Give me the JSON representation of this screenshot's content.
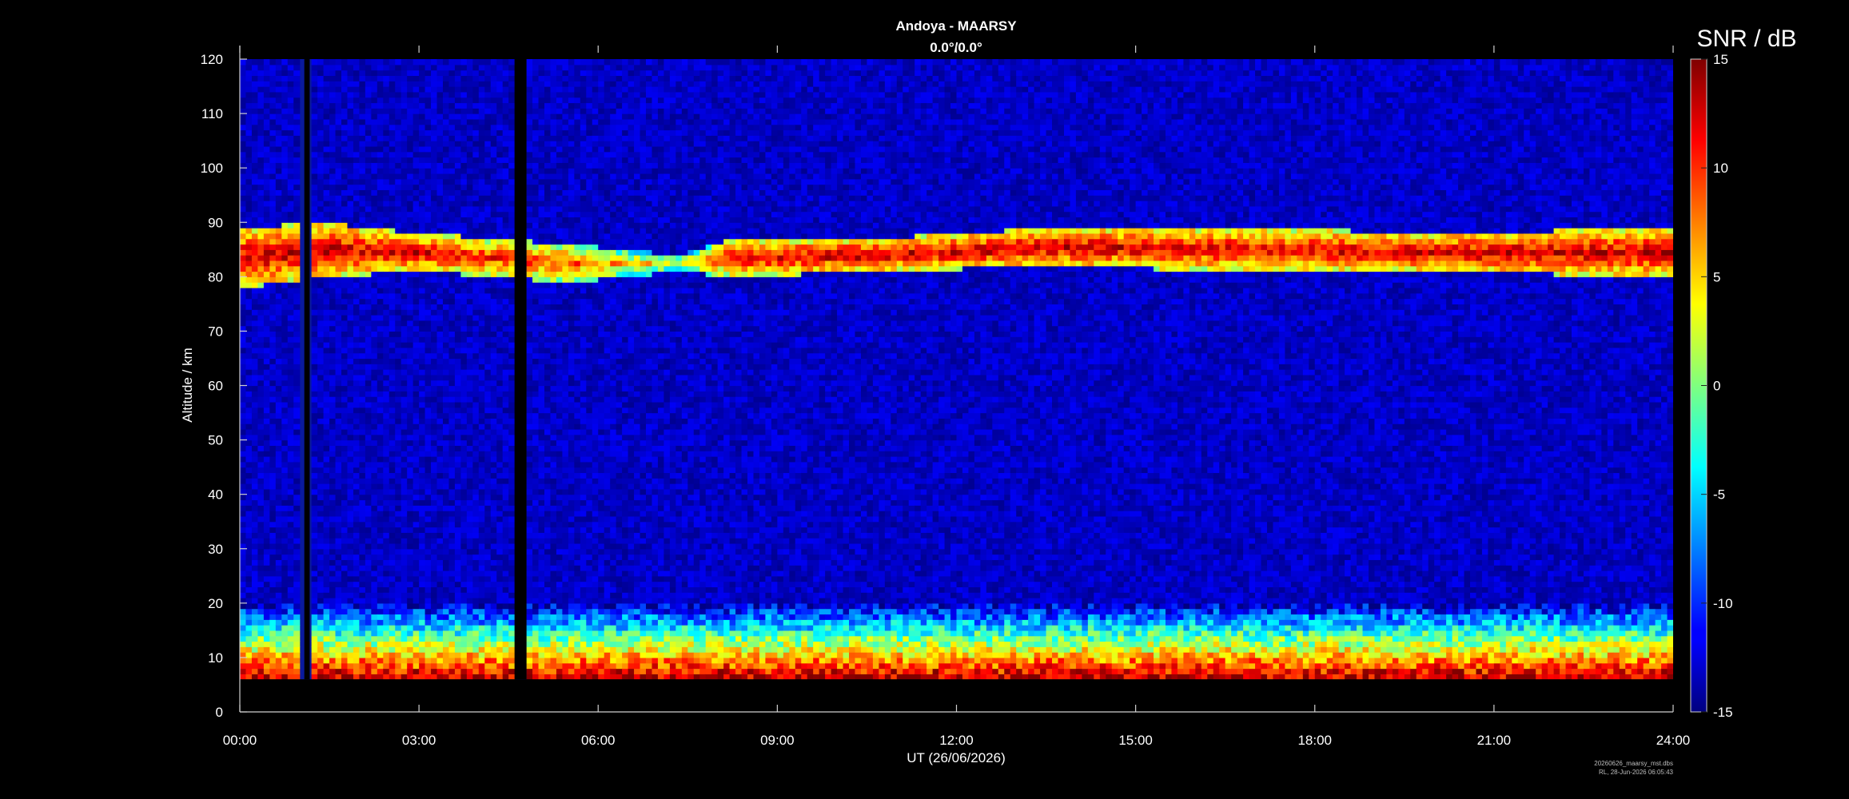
{
  "chart_data": {
    "type": "heatmap",
    "title": "Andoya - MAARSY",
    "subtitle": "0.0°/0.0°",
    "xlabel": "UT (26/06/2026)",
    "ylabel": "Altitude / km",
    "colorbar_label": "SNR / dB",
    "x_ticks": [
      "00:00",
      "03:00",
      "06:00",
      "09:00",
      "12:00",
      "15:00",
      "18:00",
      "21:00",
      "24:00"
    ],
    "xlim_hours": [
      0,
      24
    ],
    "y_ticks": [
      0,
      10,
      20,
      30,
      40,
      50,
      60,
      70,
      80,
      90,
      100,
      110,
      120
    ],
    "ylim": [
      0,
      120
    ],
    "colorbar_ticks": [
      -15,
      -10,
      -5,
      0,
      5,
      10,
      15
    ],
    "clim": [
      -15,
      15
    ],
    "colormap": "jet",
    "background_color": "#000000",
    "data_gaps_hours": [
      [
        1.08,
        1.17
      ],
      [
        4.6,
        4.8
      ]
    ],
    "lowest_altitude_km": 6,
    "pmse_layer": [
      {
        "time": 0.0,
        "bottom": 78,
        "top": 89,
        "snr": 13
      },
      {
        "time": 1.3,
        "bottom": 80,
        "top": 90,
        "snr": 13
      },
      {
        "time": 3.0,
        "bottom": 81,
        "top": 88,
        "snr": 12
      },
      {
        "time": 5.5,
        "bottom": 79,
        "top": 86,
        "snr": 9
      },
      {
        "time": 7.3,
        "bottom": 81,
        "top": 84,
        "snr": 3
      },
      {
        "time": 8.2,
        "bottom": 80,
        "top": 87,
        "snr": 12
      },
      {
        "time": 10.5,
        "bottom": 81,
        "top": 87,
        "snr": 13
      },
      {
        "time": 13.5,
        "bottom": 82,
        "top": 89,
        "snr": 13
      },
      {
        "time": 17.0,
        "bottom": 81,
        "top": 89,
        "snr": 12
      },
      {
        "time": 20.0,
        "bottom": 81,
        "top": 88,
        "snr": 13
      },
      {
        "time": 24.0,
        "bottom": 80,
        "top": 89,
        "snr": 13
      }
    ],
    "noise_floor_snr": -13,
    "lower_echo_top_km": 20
  },
  "footer": {
    "line1": "20260626_maarsy_mst.dbs",
    "line2": "RL, 28-Jun-2026 06:05:43"
  }
}
